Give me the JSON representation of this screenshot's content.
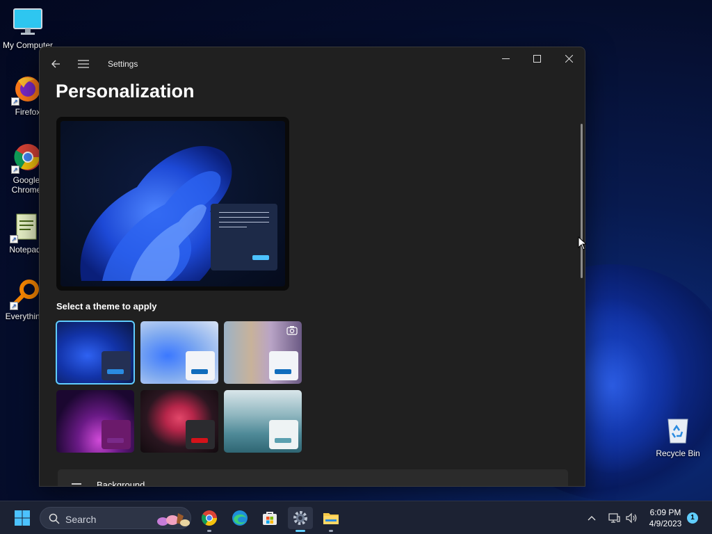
{
  "desktop": {
    "icons": [
      {
        "label": "My Computer"
      },
      {
        "label": "Firefox"
      },
      {
        "label": "Google Chrome"
      },
      {
        "label": "Notepad"
      },
      {
        "label": "Everything"
      },
      {
        "label": "Recycle Bin"
      }
    ]
  },
  "window": {
    "app_title": "Settings",
    "page_title": "Personalization",
    "theme_section_label": "Select a theme to apply",
    "themes": [
      {
        "name": "windows-dark-theme",
        "selected": true,
        "accent": "#2a7de1"
      },
      {
        "name": "windows-light-theme",
        "selected": false,
        "accent": "#0f6cbd"
      },
      {
        "name": "spotlight-theme",
        "selected": false,
        "accent": "#0f6cbd"
      },
      {
        "name": "glow-theme",
        "selected": false,
        "accent": "#6b1a6b"
      },
      {
        "name": "captured-motion-theme",
        "selected": false,
        "accent": "#d4121a"
      },
      {
        "name": "flow-theme",
        "selected": false,
        "accent": "#5aa0b0"
      }
    ],
    "background_row_label": "Background"
  },
  "taskbar": {
    "search_placeholder": "Search",
    "time": "6:09 PM",
    "date": "4/9/2023",
    "notification_count": "1"
  },
  "colors": {
    "accent": "#60cdff",
    "window_bg": "#202020",
    "taskbar_bg": "#1c2233"
  }
}
